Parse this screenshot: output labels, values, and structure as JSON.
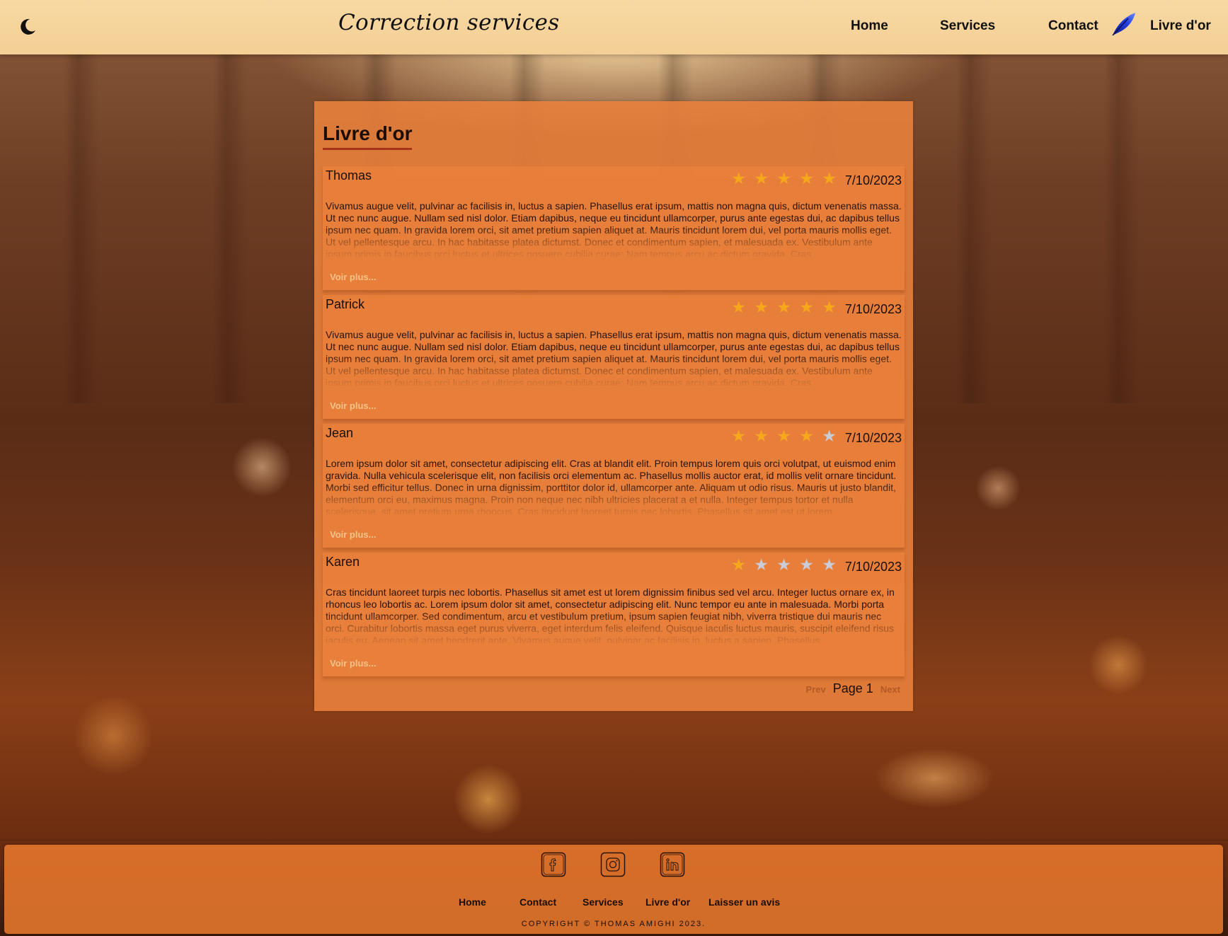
{
  "header": {
    "brand": "Correction services",
    "nav": {
      "home": "Home",
      "services": "Services",
      "contact": "Contact",
      "guestbook": "Livre d'or"
    }
  },
  "main": {
    "title": "Livre d'or",
    "more_label": "Voir plus...",
    "reviews": [
      {
        "name": "Thomas",
        "rating": 5,
        "date": "7/10/2023",
        "text": "Vivamus augue velit, pulvinar ac facilisis in, luctus a sapien. Phasellus erat ipsum, mattis non magna quis, dictum venenatis massa. Ut nec nunc augue. Nullam sed nisl dolor. Etiam dapibus, neque eu tincidunt ullamcorper, purus ante egestas dui, ac dapibus tellus ipsum nec quam. In gravida lorem orci, sit amet pretium sapien aliquet at. Mauris tincidunt lorem dui, vel porta mauris mollis eget. Ut vel pellentesque arcu. In hac habitasse platea dictumst. Donec et condimentum sapien, et malesuada ex. Vestibulum ante ipsum primis in faucibus orci luctus et ultrices posuere cubilia curae; Nam tempus arcu ac dictum gravida. Cras"
      },
      {
        "name": "Patrick",
        "rating": 5,
        "date": "7/10/2023",
        "text": "Vivamus augue velit, pulvinar ac facilisis in, luctus a sapien. Phasellus erat ipsum, mattis non magna quis, dictum venenatis massa. Ut nec nunc augue. Nullam sed nisl dolor. Etiam dapibus, neque eu tincidunt ullamcorper, purus ante egestas dui, ac dapibus tellus ipsum nec quam. In gravida lorem orci, sit amet pretium sapien aliquet at. Mauris tincidunt lorem dui, vel porta mauris mollis eget. Ut vel pellentesque arcu. In hac habitasse platea dictumst. Donec et condimentum sapien, et malesuada ex. Vestibulum ante ipsum primis in faucibus orci luctus et ultrices posuere cubilia curae; Nam tempus arcu ac dictum gravida. Cras"
      },
      {
        "name": "Jean",
        "rating": 4,
        "date": "7/10/2023",
        "text": "Lorem ipsum dolor sit amet, consectetur adipiscing elit. Cras at blandit elit. Proin tempus lorem quis orci volutpat, ut euismod enim gravida. Nulla vehicula scelerisque elit, non facilisis orci elementum ac. Phasellus mollis auctor erat, id mollis velit ornare tincidunt. Morbi sed efficitur tellus. Donec in urna dignissim, porttitor dolor id, ullamcorper ante. Aliquam ut odio risus. Mauris ut justo blandit, elementum orci eu, maximus magna. Proin non neque nec nibh ultricies placerat a et nulla. Integer tempus tortor et nulla scelerisque, sit amet pretium urna rhoncus. Cras tincidunt laoreet turpis nec lobortis. Phasellus sit amet est ut lorem"
      },
      {
        "name": "Karen",
        "rating": 1,
        "date": "7/10/2023",
        "text": "Cras tincidunt laoreet turpis nec lobortis. Phasellus sit amet est ut lorem dignissim finibus sed vel arcu. Integer luctus ornare ex, in rhoncus leo lobortis ac. Lorem ipsum dolor sit amet, consectetur adipiscing elit. Nunc tempor eu ante in malesuada. Morbi porta tincidunt ullamcorper. Sed condimentum, arcu et vestibulum pretium, ipsum sapien feugiat nibh, viverra tristique dui mauris nec orci. Curabitur lobortis massa eget purus viverra, eget interdum felis eleifend. Quisque iaculis luctus mauris, suscipit eleifend risus iaculis eu. Aenean sit amet hendrerit ante. Vivamus augue velit, pulvinar ac facilisis in, luctus a sapien. Phasellus"
      }
    ],
    "pager": {
      "prev": "Prev",
      "page": "Page 1",
      "next": "Next"
    }
  },
  "footer": {
    "social": [
      "facebook-icon",
      "instagram-icon",
      "linkedin-icon"
    ],
    "links": {
      "home": "Home",
      "contact": "Contact",
      "services": "Services",
      "guestbook": "Livre d'or",
      "review": "Laisser un avis"
    },
    "copyright": "COPYRIGHT © THOMAS AMIGHI 2023."
  },
  "colors": {
    "star_on": "#f5a81b",
    "star_off": "#c9cbd6",
    "accent_underline": "#a8331b"
  }
}
